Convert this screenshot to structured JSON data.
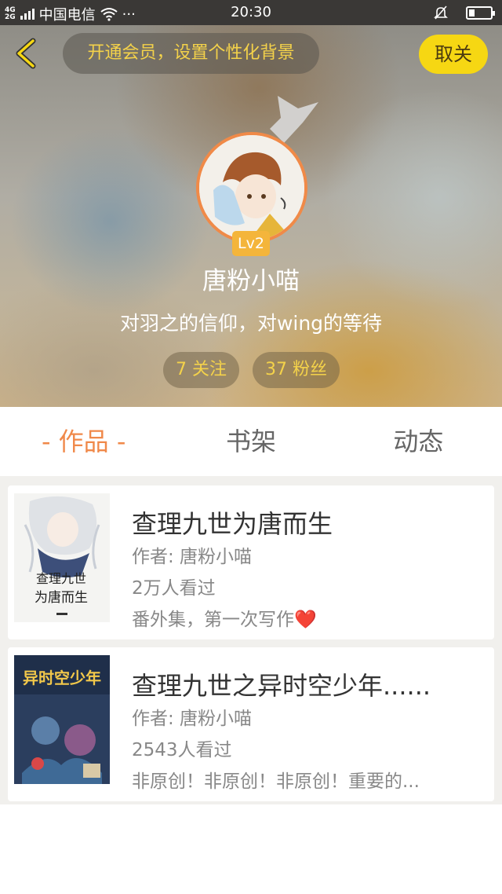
{
  "status_bar": {
    "network": [
      "4G",
      "2G"
    ],
    "carrier": "中国电信",
    "more": "···",
    "time": "20:30"
  },
  "header": {
    "vip_prompt": "开通会员，设置个性化背景",
    "unfollow_label": "取关"
  },
  "profile": {
    "level": "Lv2",
    "username": "唐粉小喵",
    "bio": "对羽之的信仰，对wing的等待",
    "following": "7 关注",
    "fans": "37 粉丝"
  },
  "tabs": [
    {
      "label": "- 作品 -",
      "active": true
    },
    {
      "label": "书架",
      "active": false
    },
    {
      "label": "动态",
      "active": false
    }
  ],
  "books": [
    {
      "title": "查理九世为唐而生",
      "author": "作者: 唐粉小喵",
      "views": "2万人看过",
      "desc": "番外集，第一次写作",
      "desc_emoji": "❤️",
      "cover_text": [
        "查理九世",
        "为唐而生"
      ]
    },
    {
      "title": "查理九世之异时空少年......",
      "author": "作者: 唐粉小喵",
      "views": "2543人看过",
      "desc": "非原创！非原创！非原创！重要的...",
      "cover_text": [
        "异时空少年"
      ]
    }
  ],
  "colors": {
    "accent_orange": "#f0894a",
    "accent_yellow": "#f6d713",
    "pill_text": "#f4d24a"
  }
}
